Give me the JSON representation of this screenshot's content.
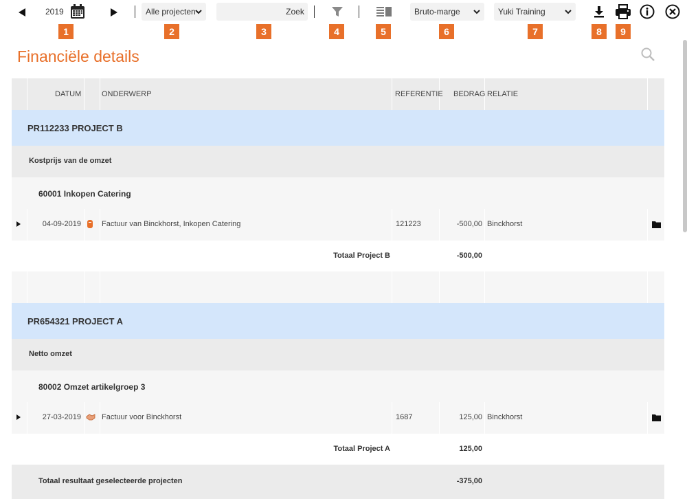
{
  "toolbar": {
    "year": "2019",
    "project_filter": "Alle projecten",
    "search_placeholder": "",
    "search_button": "Zoek",
    "view_select": "Bruto-marge",
    "administration": "Yuki Training"
  },
  "badges": [
    "1",
    "2",
    "3",
    "4",
    "5",
    "6",
    "7",
    "8",
    "9"
  ],
  "page": {
    "title": "Financiële details"
  },
  "columns": {
    "datum": "DATUM",
    "onderwerp": "ONDERWERP",
    "referentie": "REFERENTIE",
    "bedrag": "BEDRAG",
    "relatie": "RELATIE"
  },
  "groups": [
    {
      "project": "PR112233 PROJECT B",
      "category": "Kostprijs van de omzet",
      "account": "60001 Inkopen Catering",
      "row": {
        "datum": "04-09-2019",
        "onderwerp": "Factuur van Binckhorst, Inkopen Catering",
        "referentie": "121223",
        "bedrag": "-500,00",
        "relatie": "Binckhorst"
      },
      "total_label": "Totaal Project B",
      "total_value": "-500,00"
    },
    {
      "project": "PR654321 PROJECT A",
      "category": "Netto omzet",
      "account": "80002 Omzet artikelgroep 3",
      "row": {
        "datum": "27-03-2019",
        "onderwerp": "Factuur voor Binckhorst",
        "referentie": "1687",
        "bedrag": "125,00",
        "relatie": "Binckhorst"
      },
      "total_label": "Totaal Project A",
      "total_value": "125,00"
    }
  ],
  "grand_total": {
    "label": "Totaal resultaat geselecteerde projecten",
    "value": "-375,00"
  },
  "colors": {
    "accent": "#e8702a",
    "project_row": "#d4e6fb",
    "header_row": "#ebebeb"
  }
}
